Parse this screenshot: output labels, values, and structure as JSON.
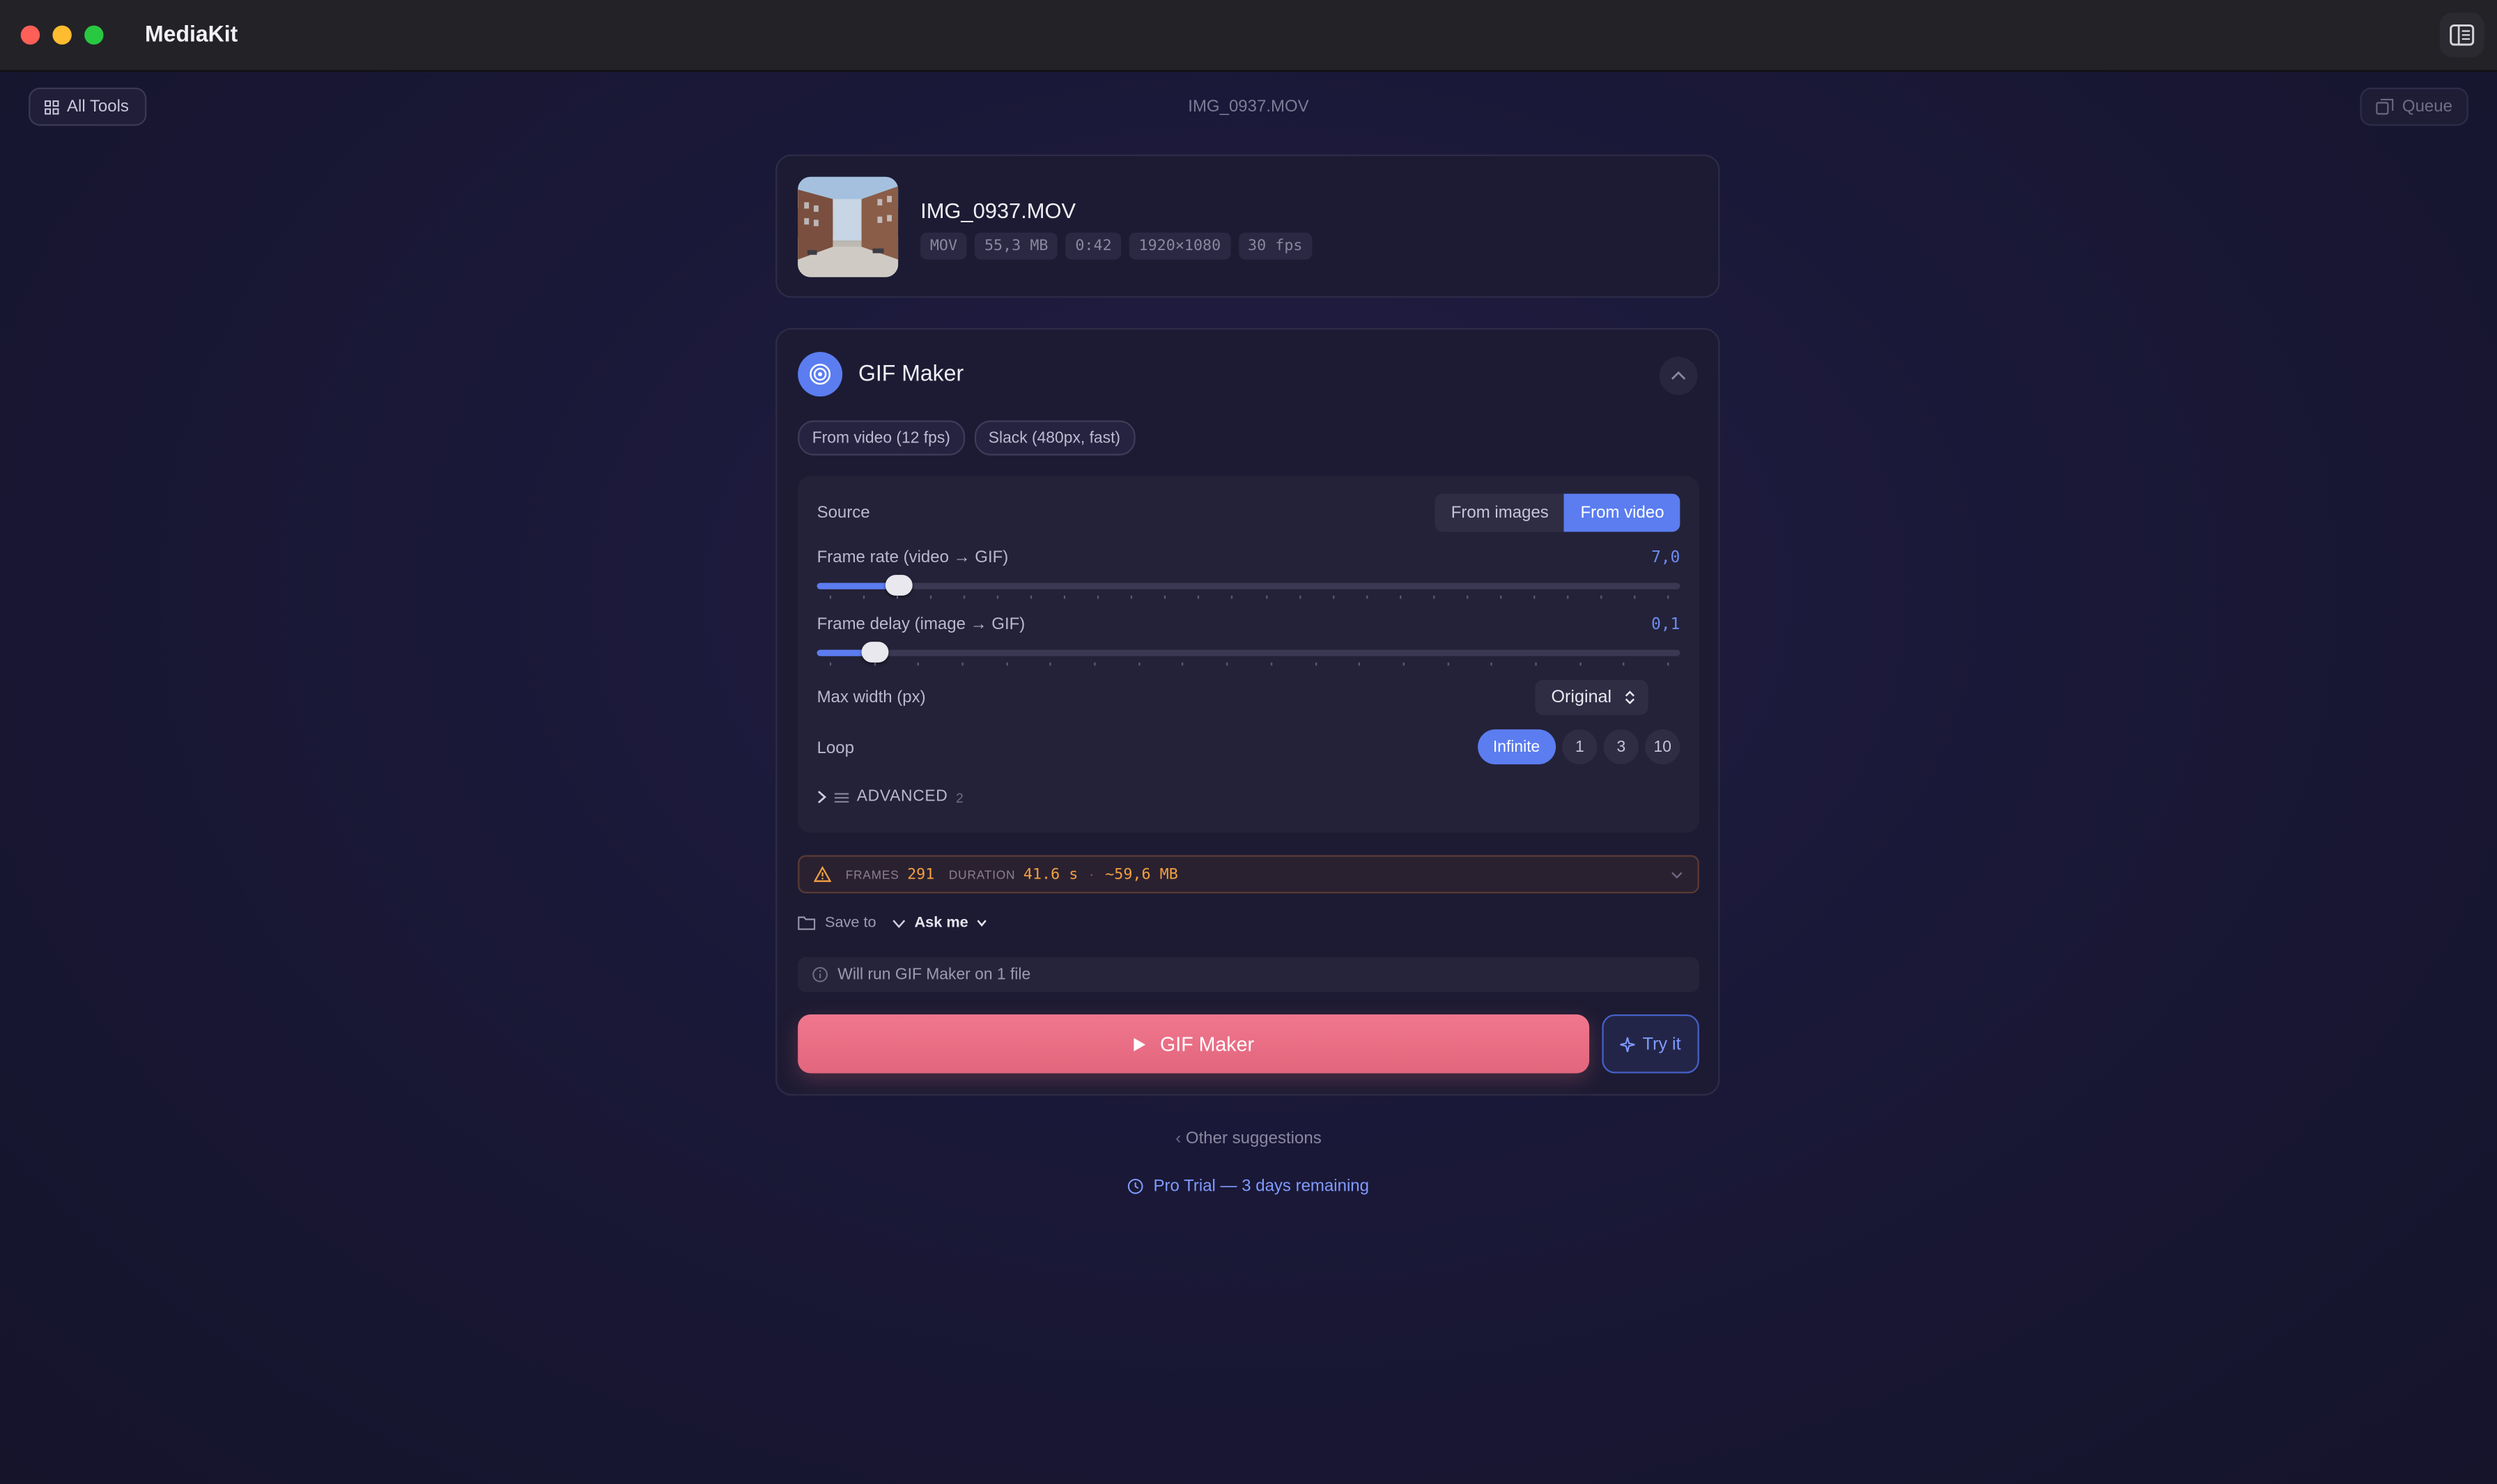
{
  "window": {
    "app_title": "MediaKit"
  },
  "toolbar": {
    "all_tools_label": "All Tools",
    "current_file": "IMG_0937.MOV",
    "queue_label": "Queue"
  },
  "file": {
    "name": "IMG_0937.MOV",
    "format": "MOV",
    "size": "55,3 MB",
    "duration": "0:42",
    "resolution": "1920×1080",
    "fps": "30 fps"
  },
  "tool": {
    "title": "GIF Maker",
    "presets": [
      "From video (12 fps)",
      "Slack (480px, fast)"
    ],
    "source": {
      "label": "Source",
      "options": [
        "From images",
        "From video"
      ],
      "selected": "From video"
    },
    "frame_rate": {
      "label": "Frame rate (video → GIF)",
      "value": "7,0",
      "fraction": 0.094,
      "ticks": 26
    },
    "frame_delay": {
      "label": "Frame delay (image → GIF)",
      "value": "0,1",
      "fraction": 0.067,
      "ticks": 20
    },
    "max_width": {
      "label": "Max width (px)",
      "value": "Original"
    },
    "loop": {
      "label": "Loop",
      "options": [
        "Infinite",
        "1",
        "3",
        "10"
      ],
      "selected": "Infinite"
    },
    "advanced": {
      "label": "ADVANCED",
      "count": "2"
    }
  },
  "summary": {
    "frames_key": "FRAMES",
    "frames_value": "291",
    "duration_key": "DURATION",
    "duration_value": "41.6 s",
    "separator": "·",
    "size_estimate": "~59,6 MB"
  },
  "save": {
    "label": "Save to",
    "value": "Ask me"
  },
  "info_text": "Will run GIF Maker on 1 file",
  "actions": {
    "run_label": "GIF Maker",
    "try_label": "Try it"
  },
  "footer": {
    "other_suggestions": "Other suggestions",
    "trial": "Pro Trial — 3 days remaining"
  },
  "colors": {
    "accent": "#5b7df0",
    "run_button": "#e8697f",
    "warning": "#f3a040"
  }
}
